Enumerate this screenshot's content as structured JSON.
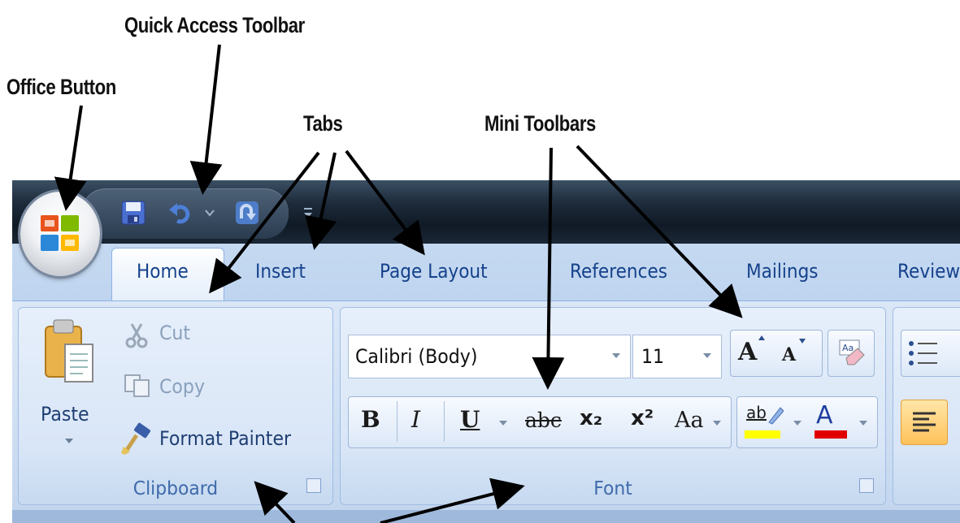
{
  "callouts": {
    "quick_access_toolbar": "Quick Access Toolbar",
    "office_button": "Office Button",
    "tabs": "Tabs",
    "mini_toolbars": "Mini Toolbars"
  },
  "tabs": [
    "Home",
    "Insert",
    "Page Layout",
    "References",
    "Mailings",
    "Review"
  ],
  "clipboard": {
    "paste": "Paste",
    "cut": "Cut",
    "copy": "Copy",
    "format_painter": "Format Painter",
    "group_label": "Clipboard"
  },
  "font": {
    "font_name": "Calibri (Body)",
    "font_size": "11",
    "group_label": "Font",
    "bold": "B",
    "italic": "I",
    "underline": "U",
    "strikethrough": "abc",
    "subscript": "x₂",
    "superscript": "x²",
    "change_case": "Aa",
    "grow_font": "A",
    "shrink_font": "A",
    "highlight": "ab",
    "font_color": "A"
  },
  "colors": {
    "tab_text": "#15428b",
    "highlight_yellow": "#ffff00",
    "font_color_red": "#e00000",
    "titlebar": "#101a26",
    "ribbon": "#cfdff3"
  },
  "icons": [
    "office-logo-icon",
    "save-icon",
    "undo-icon",
    "redo-icon",
    "customize-qat-icon",
    "paste-icon",
    "cut-icon",
    "copy-icon",
    "format-painter-icon",
    "bullets-icon",
    "align-left-icon",
    "clear-formatting-icon"
  ]
}
